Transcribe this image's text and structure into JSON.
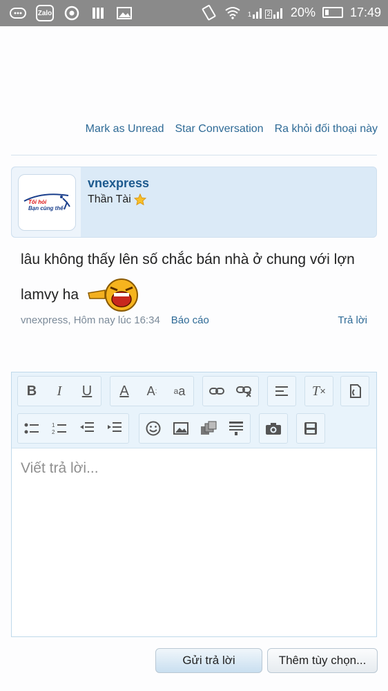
{
  "status_bar": {
    "zalo_label": "Zalo",
    "sim1": "1",
    "sim2": "2",
    "battery": "20%",
    "time": "17:49",
    "icons": [
      "message-icon",
      "zalo-icon",
      "chrome-icon",
      "book-icon",
      "gallery-icon",
      "rotate-icon",
      "wifi-icon",
      "signal-icon",
      "battery-icon"
    ]
  },
  "thread_actions": {
    "mark_unread": "Mark as Unread",
    "star": "Star Conversation",
    "leave": "Ra khỏi đối thoại này"
  },
  "message": {
    "username": "vnexpress",
    "user_title": "Thần Tài",
    "text": "lâu không thấy lên số chắc bán nhà ở chung với lợn lamvy ha",
    "author": "vnexpress",
    "timestamp": "Hôm nay lúc 16:34",
    "report": "Báo cáo",
    "reply": "Trả lời",
    "avatar_logo_line1": "Tôi hỏi",
    "avatar_logo_line2": "Bạn cùng thế"
  },
  "editor": {
    "placeholder": "Viết trả lời..."
  },
  "buttons": {
    "send": "Gửi trả lời",
    "more": "Thêm tùy chọn..."
  },
  "colors": {
    "link": "#2e6a96",
    "card_bg": "#dbeaf7",
    "status_bar": "#8a8a8a"
  }
}
